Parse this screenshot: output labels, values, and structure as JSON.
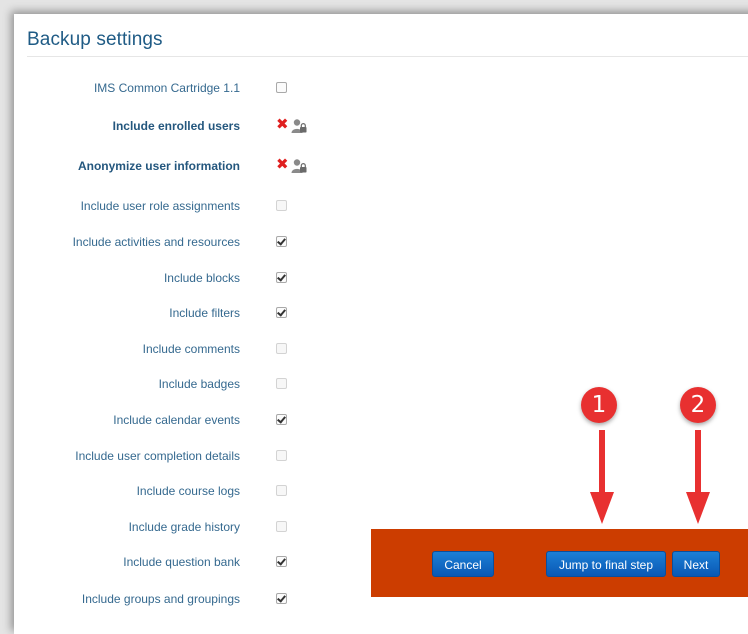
{
  "page": {
    "title": "Backup settings"
  },
  "settings": [
    {
      "label": "IMS Common Cartridge 1.1",
      "state": "unchecked",
      "bold": false
    },
    {
      "label": "Include enrolled users",
      "state": "locked-no",
      "bold": true
    },
    {
      "label": "Anonymize user information",
      "state": "locked-no",
      "bold": true
    },
    {
      "label": "Include user role assignments",
      "state": "disabled",
      "bold": false
    },
    {
      "label": "Include activities and resources",
      "state": "checked",
      "bold": false
    },
    {
      "label": "Include blocks",
      "state": "checked",
      "bold": false
    },
    {
      "label": "Include filters",
      "state": "checked",
      "bold": false
    },
    {
      "label": "Include comments",
      "state": "disabled",
      "bold": false
    },
    {
      "label": "Include badges",
      "state": "disabled",
      "bold": false
    },
    {
      "label": "Include calendar events",
      "state": "checked",
      "bold": false
    },
    {
      "label": "Include user completion details",
      "state": "disabled",
      "bold": false
    },
    {
      "label": "Include course logs",
      "state": "disabled",
      "bold": false
    },
    {
      "label": "Include grade history",
      "state": "disabled",
      "bold": false
    },
    {
      "label": "Include question bank",
      "state": "checked",
      "bold": false
    },
    {
      "label": "Include groups and groupings",
      "state": "checked",
      "bold": false
    }
  ],
  "icons": {
    "not_included": "x-icon",
    "locked": "user-lock-icon"
  },
  "footer": {
    "cancel_label": "Cancel",
    "jump_label": "Jump to final step",
    "next_label": "Next",
    "background": "#cc3d00"
  },
  "annotations": [
    {
      "number": "1",
      "color": "#e83030"
    },
    {
      "number": "2",
      "color": "#e83030"
    }
  ]
}
